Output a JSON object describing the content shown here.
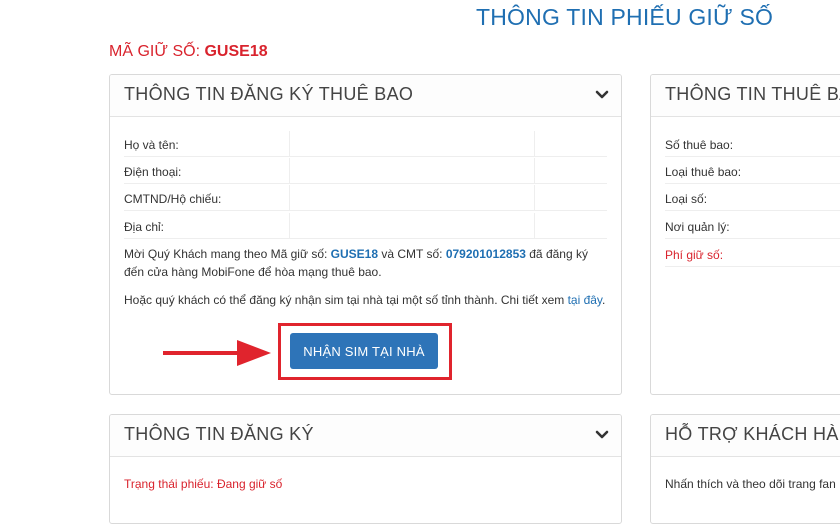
{
  "page_title": "THÔNG TIN PHIẾU GIỮ SỐ",
  "hold_code": {
    "label": "Mã giữ số:",
    "value": "GUSE18"
  },
  "registration_panel": {
    "title": "THÔNG TIN ĐĂNG KÝ THUÊ BAO",
    "fields": [
      "Họ và tên:",
      "Điện thoại:",
      "CMTND/Hộ chiếu:",
      "Địa chỉ:"
    ],
    "notice": {
      "part1": "Mời Quý Khách mang theo Mã giữ số: ",
      "code": "GUSE18",
      "part2": " và CMT số: ",
      "id_number": "079201012853",
      "part3": " đã đăng ký đến cửa hàng MobiFone để hòa mạng thuê bao."
    },
    "alt_notice": {
      "text": "Hoặc quý khách có thể đăng ký nhận sim tại nhà tại một số tỉnh thành. Chi tiết xem ",
      "link": "tại đây",
      "end": "."
    },
    "button_label": "NHẬN SIM TẠI NHÀ"
  },
  "subscriber_panel": {
    "title": "THÔNG TIN THUÊ BAO",
    "fields": [
      "Số thuê bao:",
      "Loại thuê bao:",
      "Loại số:",
      "Nơi quản lý:",
      "Phí giữ số:"
    ]
  },
  "register_panel": {
    "title": "THÔNG TIN ĐĂNG KÝ",
    "status": "Trạng thái phiếu: Đang giữ số"
  },
  "support_panel": {
    "title": "HỖ TRỢ KHÁCH HÀNG",
    "text": "Nhấn thích và theo dõi trang fan"
  },
  "colors": {
    "accent": "#1f6fb2",
    "danger": "#d9232d",
    "button": "#2e74b8"
  }
}
